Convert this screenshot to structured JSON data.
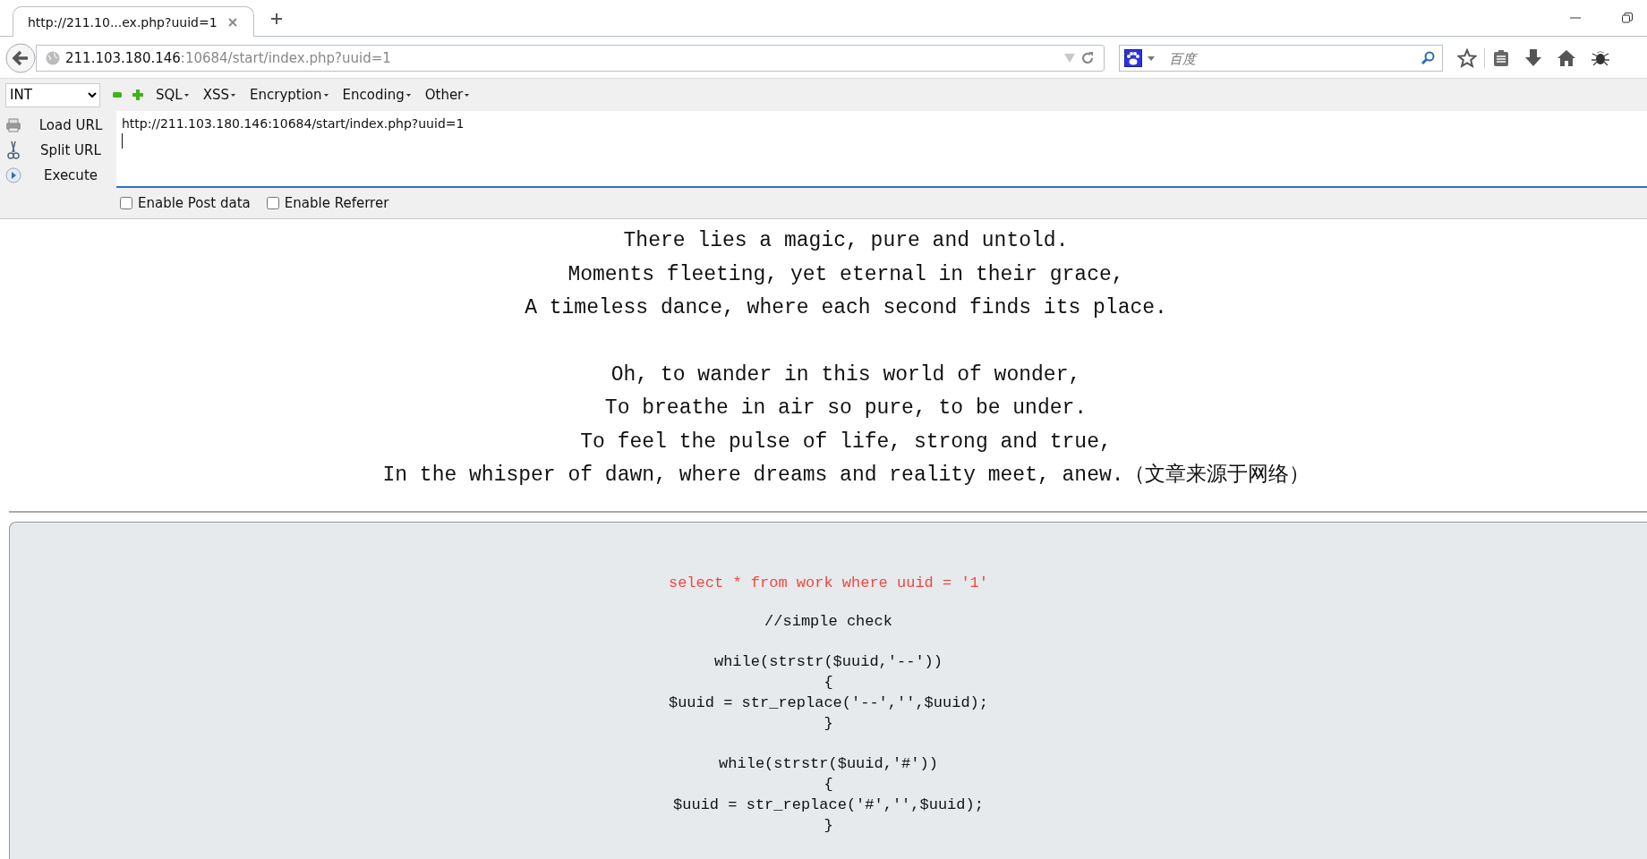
{
  "browser": {
    "tabs": [
      {
        "title": "http://211.10...ex.php?uuid=1",
        "selected": true
      }
    ],
    "address": {
      "host": "211.103.180.146",
      "rest": ":10684/start/index.php?uuid=1"
    },
    "search": {
      "placeholder": "百度"
    }
  },
  "hackbar": {
    "select": "INT",
    "menus": [
      "SQL",
      "XSS",
      "Encryption",
      "Encoding",
      "Other"
    ],
    "actions": [
      {
        "label": "Load URL",
        "kind": "load"
      },
      {
        "label": "Split URL",
        "kind": "split"
      },
      {
        "label": "Execute",
        "kind": "execute"
      }
    ],
    "url": "http://211.103.180.146:10684/start/index.php?uuid=1",
    "options": [
      {
        "label": "Enable Post data",
        "checked": false
      },
      {
        "label": "Enable Referrer",
        "checked": false
      }
    ]
  },
  "page": {
    "poem": [
      [
        "There lies a magic, pure and untold.",
        "Moments fleeting, yet eternal in their grace,",
        "A timeless dance, where each second finds its place."
      ],
      [
        "Oh, to wander in this world of wonder,",
        "To breathe in air so pure, to be under.",
        "To feel the pulse of life, strong and true,",
        "In the whisper of dawn, where dreams and reality meet, anew.（文章来源于网络）"
      ]
    ],
    "query": "select * from work where uuid = '1'",
    "code": [
      [
        "//simple check"
      ],
      [
        "while(strstr($uuid,'--'))",
        "{",
        "$uuid = str_replace('--','',$uuid);",
        "}"
      ],
      [
        "while(strstr($uuid,'#'))",
        "{",
        "$uuid = str_replace('#','',$uuid);",
        "}"
      ]
    ]
  }
}
